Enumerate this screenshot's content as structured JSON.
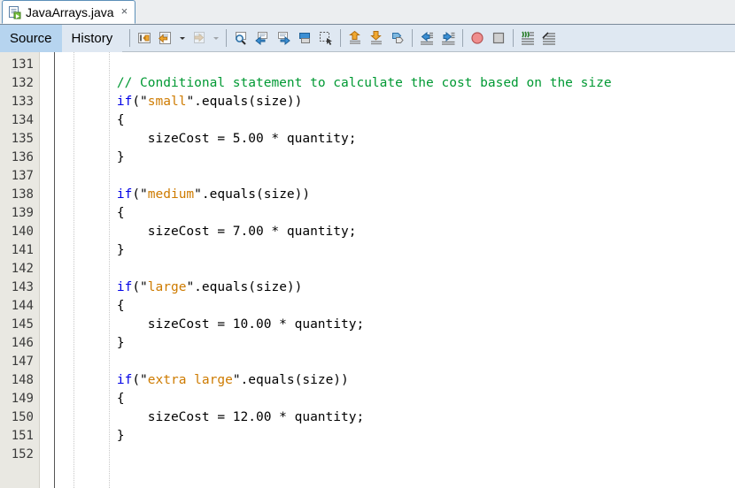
{
  "window": {
    "file_tab": {
      "title": "JavaArrays.java",
      "icon": "java-file-icon",
      "close_label": "×"
    }
  },
  "view_tabs": [
    {
      "label": "Source",
      "active": true
    },
    {
      "label": "History",
      "active": false
    }
  ],
  "toolbar": {
    "groups": [
      {
        "buttons": [
          {
            "name": "last-edit-icon",
            "title": "Last Edit"
          },
          {
            "name": "back-icon",
            "title": "Back"
          },
          {
            "name": "back-dropdown-icon",
            "title": "Back History"
          },
          {
            "name": "forward-icon",
            "title": "Forward"
          },
          {
            "name": "forward-dropdown-icon",
            "title": "Forward History"
          }
        ]
      },
      {
        "buttons": [
          {
            "name": "find-selection-icon",
            "title": "Find Selection"
          },
          {
            "name": "find-previous-icon",
            "title": "Find Previous"
          },
          {
            "name": "find-next-icon",
            "title": "Find Next"
          },
          {
            "name": "toggle-rect-selection-icon",
            "title": "Toggle Rectangular Selection"
          },
          {
            "name": "previous-bookmark-icon",
            "title": "Previous Bookmark"
          }
        ]
      },
      {
        "buttons": [
          {
            "name": "toggle-bookmark-icon",
            "title": "Toggle Bookmark"
          },
          {
            "name": "next-bookmark-icon",
            "title": "Next Bookmark"
          },
          {
            "name": "previous-error-icon",
            "title": "Previous Error"
          }
        ]
      },
      {
        "buttons": [
          {
            "name": "shift-left-icon",
            "title": "Shift Line Left"
          },
          {
            "name": "shift-right-icon",
            "title": "Shift Line Right"
          }
        ]
      },
      {
        "buttons": [
          {
            "name": "start-macro-recording-icon",
            "title": "Start Macro Recording"
          },
          {
            "name": "stop-macro-recording-icon",
            "title": "Stop Macro Recording"
          }
        ]
      },
      {
        "buttons": [
          {
            "name": "comment-icon",
            "title": "Comment"
          },
          {
            "name": "uncomment-icon",
            "title": "Uncomment"
          }
        ]
      }
    ]
  },
  "editor": {
    "first_line": 131,
    "last_line": 152,
    "colors": {
      "keyword": "#0000e6",
      "string": "#ce7b00",
      "comment": "#009933",
      "plain": "#000000",
      "gutter_bg": "#e9e8e2",
      "editor_bg": "#ffffff"
    },
    "lines": [
      {
        "number": 131,
        "tokens": []
      },
      {
        "number": 132,
        "tokens": [
          {
            "t": "        ",
            "c": "pl"
          },
          {
            "t": "// Conditional statement to calculate the cost based on the size",
            "c": "cmt"
          }
        ]
      },
      {
        "number": 133,
        "tokens": [
          {
            "t": "        ",
            "c": "pl"
          },
          {
            "t": "if",
            "c": "kw"
          },
          {
            "t": "(\"",
            "c": "pl"
          },
          {
            "t": "small",
            "c": "str"
          },
          {
            "t": "\".equals(size))",
            "c": "pl"
          }
        ]
      },
      {
        "number": 134,
        "tokens": [
          {
            "t": "        {",
            "c": "pl"
          }
        ]
      },
      {
        "number": 135,
        "tokens": [
          {
            "t": "            sizeCost = 5.00 * quantity;",
            "c": "pl"
          }
        ]
      },
      {
        "number": 136,
        "tokens": [
          {
            "t": "        }",
            "c": "pl"
          }
        ]
      },
      {
        "number": 137,
        "tokens": []
      },
      {
        "number": 138,
        "tokens": [
          {
            "t": "        ",
            "c": "pl"
          },
          {
            "t": "if",
            "c": "kw"
          },
          {
            "t": "(\"",
            "c": "pl"
          },
          {
            "t": "medium",
            "c": "str"
          },
          {
            "t": "\".equals(size))",
            "c": "pl"
          }
        ]
      },
      {
        "number": 139,
        "tokens": [
          {
            "t": "        {",
            "c": "pl"
          }
        ]
      },
      {
        "number": 140,
        "tokens": [
          {
            "t": "            sizeCost = 7.00 * quantity;",
            "c": "pl"
          }
        ]
      },
      {
        "number": 141,
        "tokens": [
          {
            "t": "        }",
            "c": "pl"
          }
        ]
      },
      {
        "number": 142,
        "tokens": []
      },
      {
        "number": 143,
        "tokens": [
          {
            "t": "        ",
            "c": "pl"
          },
          {
            "t": "if",
            "c": "kw"
          },
          {
            "t": "(\"",
            "c": "pl"
          },
          {
            "t": "large",
            "c": "str"
          },
          {
            "t": "\".equals(size))",
            "c": "pl"
          }
        ]
      },
      {
        "number": 144,
        "tokens": [
          {
            "t": "        {",
            "c": "pl"
          }
        ]
      },
      {
        "number": 145,
        "tokens": [
          {
            "t": "            sizeCost = 10.00 * quantity;",
            "c": "pl"
          }
        ]
      },
      {
        "number": 146,
        "tokens": [
          {
            "t": "        }",
            "c": "pl"
          }
        ]
      },
      {
        "number": 147,
        "tokens": []
      },
      {
        "number": 148,
        "tokens": [
          {
            "t": "        ",
            "c": "pl"
          },
          {
            "t": "if",
            "c": "kw"
          },
          {
            "t": "(\"",
            "c": "pl"
          },
          {
            "t": "extra large",
            "c": "str"
          },
          {
            "t": "\".equals(size))",
            "c": "pl"
          }
        ]
      },
      {
        "number": 149,
        "tokens": [
          {
            "t": "        {",
            "c": "pl"
          }
        ]
      },
      {
        "number": 150,
        "tokens": [
          {
            "t": "            sizeCost = 12.00 * quantity;",
            "c": "pl"
          }
        ]
      },
      {
        "number": 151,
        "tokens": [
          {
            "t": "        }",
            "c": "pl"
          }
        ]
      },
      {
        "number": 152,
        "tokens": []
      }
    ]
  }
}
